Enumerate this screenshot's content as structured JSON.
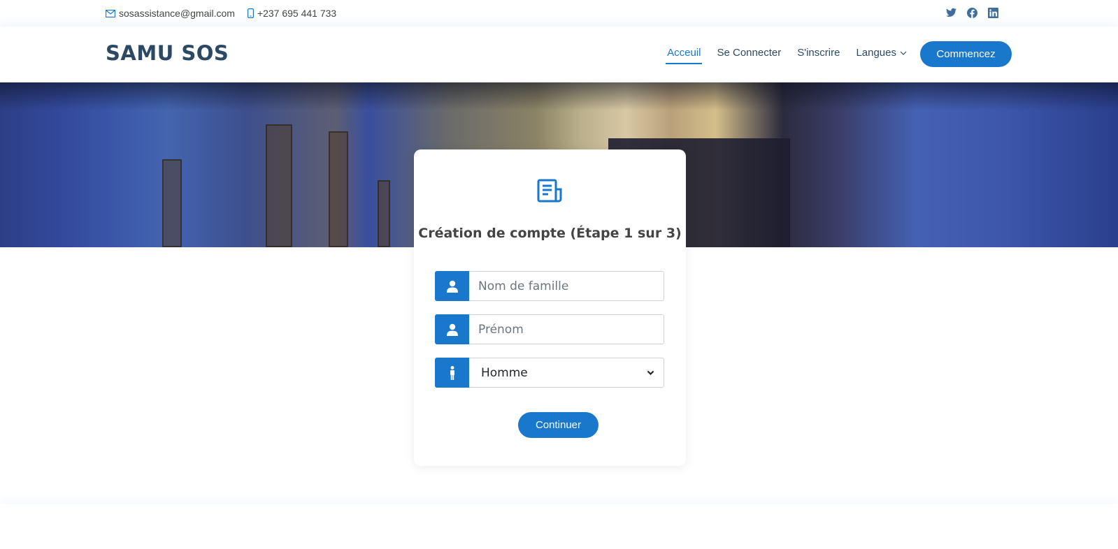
{
  "topbar": {
    "email": "sosassistance@gmail.com",
    "phone": "+237 695 441 733",
    "social": [
      "twitter-icon",
      "facebook-icon",
      "linkedin-icon"
    ]
  },
  "header": {
    "logo": "SAMU SOS",
    "nav": [
      {
        "label": "Acceuil",
        "active": true
      },
      {
        "label": "Se Connecter"
      },
      {
        "label": "S'inscrire"
      },
      {
        "label": "Langues"
      }
    ],
    "cta_label": "Commencez"
  },
  "form": {
    "title": "Création de compte (Étape 1 sur 3)",
    "last_name_placeholder": "Nom de famille",
    "first_name_placeholder": "Prénom",
    "gender_selected": "Homme",
    "submit_label": "Continuer"
  },
  "colors": {
    "accent": "#1977cc",
    "heading": "#2c4964",
    "text": "#444444"
  }
}
